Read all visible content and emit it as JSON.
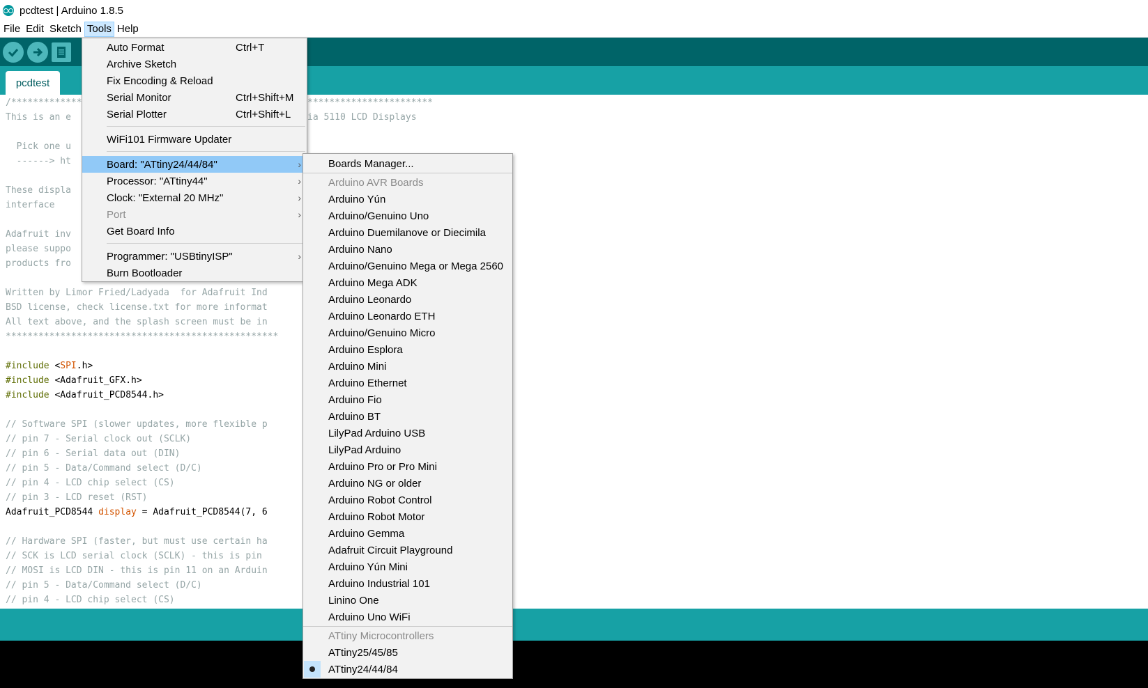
{
  "window": {
    "title": "pcdtest | Arduino 1.8.5"
  },
  "menubar": [
    "File",
    "Edit",
    "Sketch",
    "Tools",
    "Help"
  ],
  "toolbar": {
    "verify_icon": "check-icon",
    "upload_icon": "arrow-right-icon",
    "new_icon": "new-file-icon"
  },
  "tabs": [
    "pcdtest"
  ],
  "code": [
    {
      "t": "/*************",
      "k": "c"
    },
    {
      "t": "This is an e",
      "k": "c"
    },
    {
      "t": "",
      "k": "c"
    },
    {
      "t": "  Pick one u",
      "k": "c"
    },
    {
      "t": "  ------> ht",
      "k": "c"
    },
    {
      "t": "",
      "k": "c"
    },
    {
      "t": "These displa",
      "k": "c"
    },
    {
      "t": "interface",
      "k": "c"
    },
    {
      "t": "",
      "k": "c"
    },
    {
      "t": "Adafruit inv",
      "k": "c"
    },
    {
      "t": "please suppo",
      "k": "c"
    },
    {
      "t": "products fro",
      "k": "c"
    },
    {
      "t": "",
      "k": "c"
    },
    {
      "t": "Written by Limor Fried/Ladyada  for Adafruit Ind",
      "k": "c"
    },
    {
      "t": "BSD license, check license.txt for more informat",
      "k": "c"
    },
    {
      "t": "All text above, and the splash screen must be in",
      "k": "c"
    },
    {
      "t": "**************************************************",
      "k": "c"
    },
    {
      "t": "",
      "k": "c"
    },
    {
      "t": "#include <SPI.h>",
      "k": "inc",
      "lib": "SPI"
    },
    {
      "t": "#include <Adafruit_GFX.h>",
      "k": "inc"
    },
    {
      "t": "#include <Adafruit_PCD8544.h>",
      "k": "inc"
    },
    {
      "t": "",
      "k": "c"
    },
    {
      "t": "// Software SPI (slower updates, more flexible p",
      "k": "c"
    },
    {
      "t": "// pin 7 - Serial clock out (SCLK)",
      "k": "c"
    },
    {
      "t": "// pin 6 - Serial data out (DIN)",
      "k": "c"
    },
    {
      "t": "// pin 5 - Data/Command select (D/C)",
      "k": "c"
    },
    {
      "t": "// pin 4 - LCD chip select (CS)",
      "k": "c"
    },
    {
      "t": "// pin 3 - LCD reset (RST)",
      "k": "c"
    },
    {
      "t": "Adafruit_PCD8544 display = Adafruit_PCD8544(7, 6",
      "k": "decl"
    },
    {
      "t": "",
      "k": "c"
    },
    {
      "t": "// Hardware SPI (faster, but must use certain ha",
      "k": "c"
    },
    {
      "t": "// SCK is LCD serial clock (SCLK) - this is pin",
      "k": "c"
    },
    {
      "t": "// MOSI is LCD DIN - this is pin 11 on an Arduin",
      "k": "c"
    },
    {
      "t": "// pin 5 - Data/Command select (D/C)",
      "k": "c"
    },
    {
      "t": "// pin 4 - LCD chip select (CS)",
      "k": "c"
    }
  ],
  "code_right_top": [
    "ia 5110 LCD Displays"
  ],
  "code_right_stars": "***********************",
  "tools_menu": {
    "items": [
      {
        "label": "Auto Format",
        "shortcut": "Ctrl+T"
      },
      {
        "label": "Archive Sketch",
        "shortcut": ""
      },
      {
        "label": "Fix Encoding & Reload",
        "shortcut": ""
      },
      {
        "label": "Serial Monitor",
        "shortcut": "Ctrl+Shift+M"
      },
      {
        "label": "Serial Plotter",
        "shortcut": "Ctrl+Shift+L"
      },
      {
        "label": "WiFi101 Firmware Updater",
        "shortcut": ""
      },
      {
        "label": "Board: \"ATtiny24/44/84\"",
        "shortcut": ""
      },
      {
        "label": "Processor: \"ATtiny44\"",
        "shortcut": ""
      },
      {
        "label": "Clock: \"External 20 MHz\"",
        "shortcut": ""
      },
      {
        "label": "Port",
        "shortcut": ""
      },
      {
        "label": "Get Board Info",
        "shortcut": ""
      },
      {
        "label": "Programmer: \"USBtinyISP\"",
        "shortcut": ""
      },
      {
        "label": "Burn Bootloader",
        "shortcut": ""
      }
    ]
  },
  "boards_menu": {
    "manager": "Boards Manager...",
    "avr_header": "Arduino AVR Boards",
    "avr_boards": [
      "Arduino Yún",
      "Arduino/Genuino Uno",
      "Arduino Duemilanove or Diecimila",
      "Arduino Nano",
      "Arduino/Genuino Mega or Mega 2560",
      "Arduino Mega ADK",
      "Arduino Leonardo",
      "Arduino Leonardo ETH",
      "Arduino/Genuino Micro",
      "Arduino Esplora",
      "Arduino Mini",
      "Arduino Ethernet",
      "Arduino Fio",
      "Arduino BT",
      "LilyPad Arduino USB",
      "LilyPad Arduino",
      "Arduino Pro or Pro Mini",
      "Arduino NG or older",
      "Arduino Robot Control",
      "Arduino Robot Motor",
      "Arduino Gemma",
      "Adafruit Circuit Playground",
      "Arduino Yún Mini",
      "Arduino Industrial 101",
      "Linino One",
      "Arduino Uno WiFi"
    ],
    "attiny_header": "ATtiny Microcontrollers",
    "attiny_boards": [
      "ATtiny25/45/85",
      "ATtiny24/44/84"
    ],
    "selected": "ATtiny24/44/84"
  }
}
